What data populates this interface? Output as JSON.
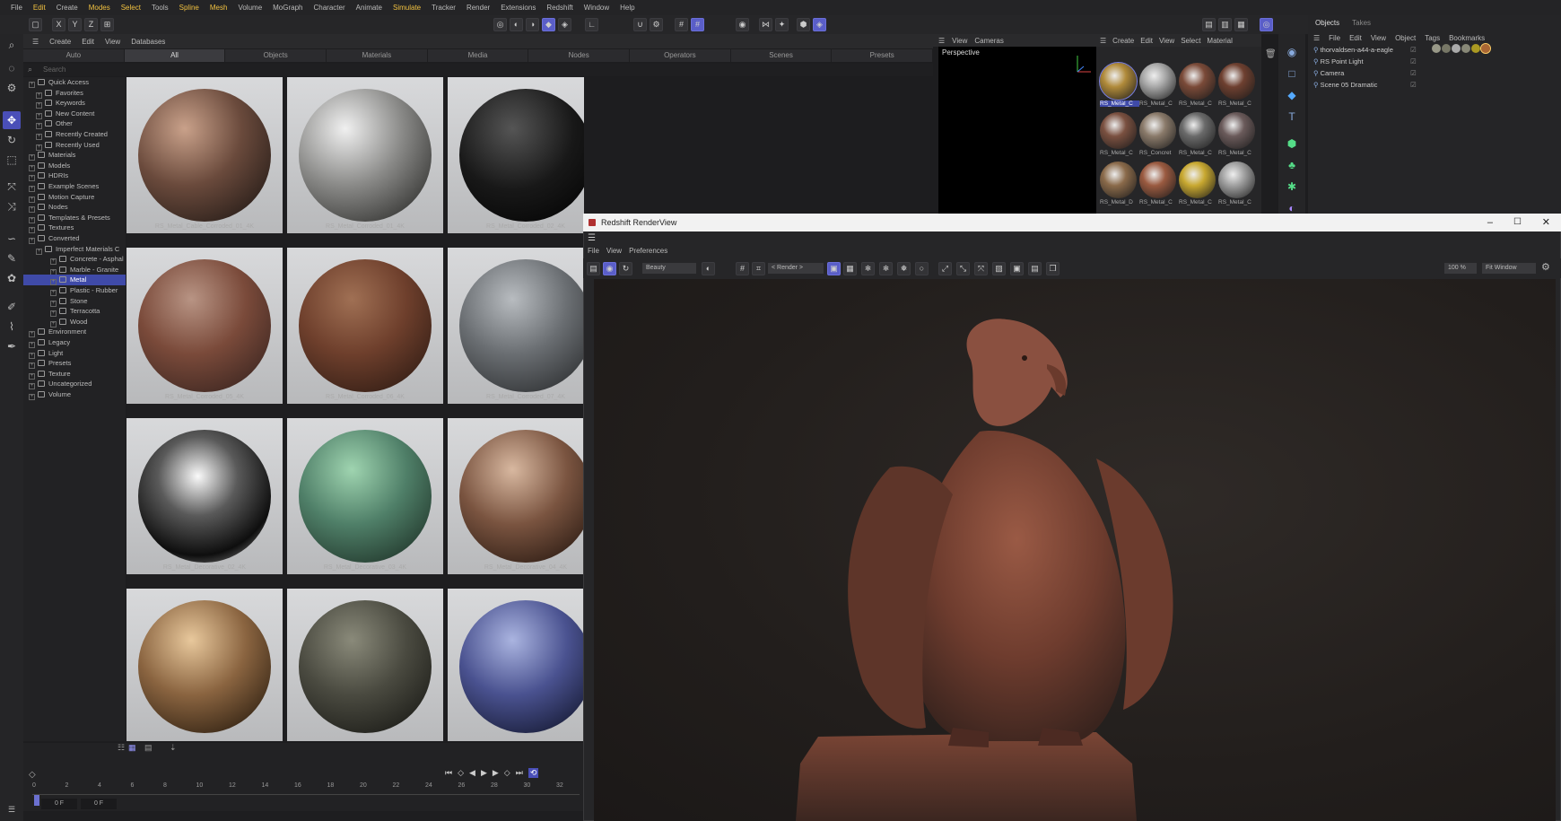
{
  "menubar": [
    "File",
    "Edit",
    "Create",
    "Modes",
    "Select",
    "Tools",
    "Spline",
    "Mesh",
    "Volume",
    "MoGraph",
    "Character",
    "Animate",
    "Simulate",
    "Tracker",
    "Render",
    "Extensions",
    "Redshift",
    "Window",
    "Help"
  ],
  "asset_browser": {
    "menu": [
      "Create",
      "Edit",
      "View",
      "Databases"
    ],
    "tabs": [
      "Auto",
      "All",
      "Objects",
      "Materials",
      "Media",
      "Nodes",
      "Operators",
      "Scenes",
      "Presets"
    ],
    "active_tab": "All",
    "search_placeholder": "Search",
    "tree": [
      "Quick Access",
      "Favorites",
      "Keywords",
      "New Content",
      "Other",
      "Recently Created",
      "Recently Used",
      "Materials",
      "Models",
      "HDRIs",
      "Example Scenes",
      "Motion Capture",
      "Nodes",
      "Templates & Presets",
      "Textures",
      "Converted",
      "Imperfect Materials C",
      "Concrete - Asphal",
      "Marble - Granite",
      "Metal",
      "Plastic - Rubber",
      "Stone",
      "Terracotta",
      "Wood",
      "Environment",
      "Legacy",
      "Light",
      "Presets",
      "Texture",
      "Uncategorized",
      "Volume"
    ],
    "selected_tree_item": "Metal",
    "assets": [
      "RS_Metal_Cable_Corroded_01_4K",
      "RS_Metal_Corroded_01_4K",
      "RS_Metal_Corroded_02_4K",
      "",
      "",
      "RS_Metal_Corroded_05_4K",
      "RS_Metal_Corroded_06_4K",
      "RS_Metal_Corroded_07_4K",
      "RS_Metal_Decorative_02_4K",
      "RS_Metal_Decorative_03_4K",
      "RS_Metal_Decorative_04_4K",
      "",
      "",
      ""
    ]
  },
  "timeline": {
    "frames": [
      "0",
      "2",
      "4",
      "6",
      "8",
      "10",
      "12",
      "14",
      "16",
      "18",
      "20",
      "22",
      "24",
      "26",
      "28",
      "30",
      "32"
    ],
    "start_field": "0 F",
    "end_field": "0 F"
  },
  "viewport": {
    "label": "Perspective",
    "menu": [
      "View",
      "Cameras"
    ]
  },
  "material_manager": {
    "menu": [
      "Create",
      "Edit",
      "View",
      "Select",
      "Material"
    ],
    "labels": [
      "RS_Metal_C",
      "RS_Metal_C",
      "RS_Metal_C",
      "RS_Metal_C",
      "RS_Metal_C",
      "RS_Concret",
      "RS_Metal_C",
      "RS_Metal_C",
      "RS_Metal_D",
      "RS_Metal_C",
      "RS_Metal_C",
      "RS_Metal_C"
    ]
  },
  "objects_panel": {
    "tabs": [
      "Objects",
      "Takes"
    ],
    "menu": [
      "File",
      "Edit",
      "View",
      "Object",
      "Tags",
      "Bookmarks"
    ],
    "objects": [
      "thorvaldsen-a44-a-eagle",
      "RS Point Light",
      "Camera",
      "Scene 05 Dramatic"
    ]
  },
  "render_view": {
    "title": "Redshift RenderView",
    "menu": [
      "File",
      "View",
      "Preferences"
    ],
    "aov": "Beauty",
    "render_mode": "< Render >",
    "zoom": "100 %",
    "fit": "Fit Window"
  }
}
